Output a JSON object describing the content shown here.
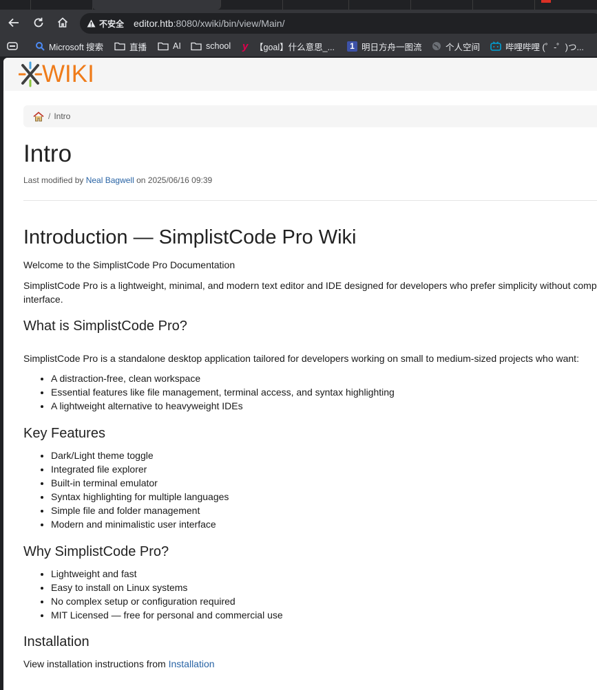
{
  "browser": {
    "security_label": "不安全",
    "url_host": "editor.htb",
    "url_rest": ":8080/xwiki/bin/view/Main/",
    "bookmarks": [
      {
        "label": "Microsoft 搜索",
        "icon": "search-icon"
      },
      {
        "label": "直播",
        "icon": "folder-icon"
      },
      {
        "label": "AI",
        "icon": "folder-icon"
      },
      {
        "label": "school",
        "icon": "folder-icon"
      },
      {
        "label": "【goal】什么意思_...",
        "icon": "y-logo-icon"
      },
      {
        "label": "明日方舟一图流",
        "icon": "one-logo-icon"
      },
      {
        "label": "个人空间",
        "icon": "globe-icon"
      },
      {
        "label": "哔哩哔哩 (゜-゜)つ...",
        "icon": "bilibili-icon"
      }
    ]
  },
  "header": {
    "logo_text": "WIKI",
    "brand_color": "#ef7c1a"
  },
  "breadcrumb": {
    "current": "Intro"
  },
  "page": {
    "title": "Intro",
    "meta_prefix": "Last modified by ",
    "meta_author": "Neal Bagwell",
    "meta_suffix": " on 2025/06/16 09:39"
  },
  "article": {
    "h1": "Introduction — SimplistCode Pro Wiki",
    "welcome": "Welcome to the SimplistCode Pro Documentation",
    "intro_line1": "SimplistCode Pro is a lightweight, minimal, and modern text editor and IDE designed for developers who prefer simplicity without comp",
    "intro_line2": "interface.",
    "what_heading": "What is SimplistCode Pro?",
    "what_text": "SimplistCode Pro is a standalone desktop application tailored for developers working on small to medium-sized projects who want:",
    "what_items": [
      "A distraction-free, clean workspace",
      "Essential features like file management, terminal access, and syntax highlighting",
      "A lightweight alternative to heavyweight IDEs"
    ],
    "features_heading": "Key Features",
    "features_items": [
      "Dark/Light theme toggle",
      "Integrated file explorer",
      "Built-in terminal emulator",
      "Syntax highlighting for multiple languages",
      "Simple file and folder management",
      "Modern and minimalistic user interface"
    ],
    "why_heading": "Why SimplistCode Pro?",
    "why_items": [
      "Lightweight and fast",
      "Easy to install on Linux systems",
      "No complex setup or configuration required",
      "MIT Licensed — free for personal and commercial use"
    ],
    "install_heading": "Installation",
    "install_prefix": "View installation instructions from ",
    "install_link": "Installation"
  }
}
